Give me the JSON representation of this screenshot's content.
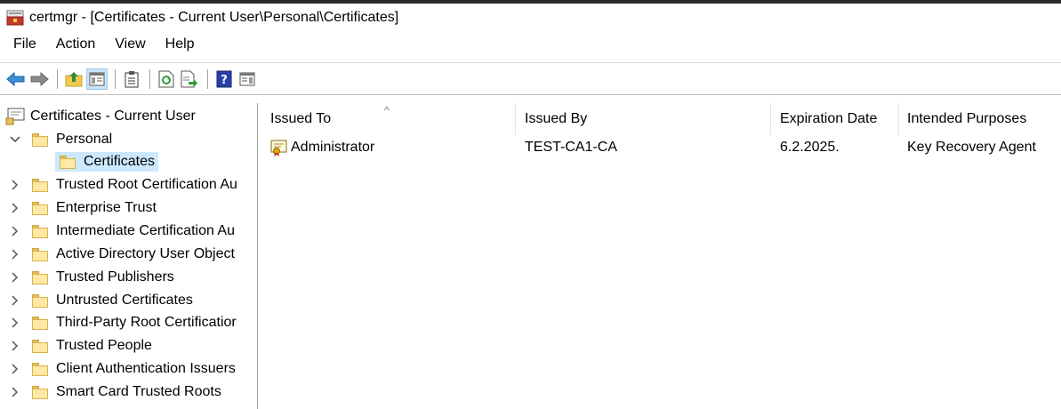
{
  "window": {
    "title": "certmgr - [Certificates - Current User\\Personal\\Certificates]"
  },
  "menu": [
    "File",
    "Action",
    "View",
    "Help"
  ],
  "toolbar": {
    "buttons": [
      "back-icon",
      "forward-icon",
      "up-folder-icon",
      "show-hide-tree-icon",
      "clipboard-icon",
      "refresh-icon",
      "export-list-icon",
      "help-icon",
      "details-pane-icon"
    ]
  },
  "tree": {
    "root": "Certificates - Current User",
    "personal": "Personal",
    "certificates": "Certificates",
    "items": [
      "Trusted Root Certification Au",
      "Enterprise Trust",
      "Intermediate Certification Au",
      "Active Directory User Object",
      "Trusted Publishers",
      "Untrusted Certificates",
      "Third-Party Root Certificatior",
      "Trusted People",
      "Client Authentication Issuers",
      "Smart Card Trusted Roots"
    ]
  },
  "list": {
    "columns": [
      "Issued To",
      "Issued By",
      "Expiration Date",
      "Intended Purposes"
    ],
    "sort_indicator": "^",
    "rows": [
      {
        "issued_to": "Administrator",
        "issued_by": "TEST-CA1-CA",
        "expiration": "6.2.2025.",
        "purposes": "Key Recovery Agent"
      }
    ]
  },
  "colors": {
    "selection": "#cce8ff",
    "folder": "#fde9a4",
    "toolbar_pressed": "#cce4f7"
  }
}
